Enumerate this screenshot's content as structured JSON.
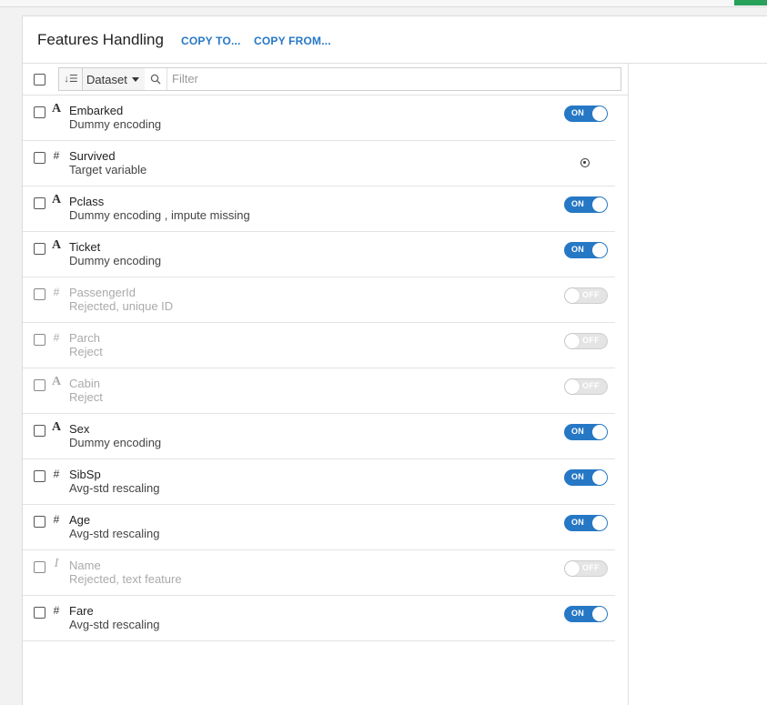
{
  "header": {
    "title": "Features Handling",
    "copy_to_label": "COPY TO...",
    "copy_from_label": "COPY FROM..."
  },
  "toolbar": {
    "sort_icon": "sort-descending-icon",
    "dataset_label": "Dataset",
    "search_icon": "search-icon",
    "filter_placeholder": "Filter",
    "filter_value": ""
  },
  "features": [
    {
      "type": "alpha",
      "icon": "A",
      "name": "Embarked",
      "desc": "Dummy encoding",
      "state": "on",
      "state_label": "ON"
    },
    {
      "type": "numeric",
      "icon": "#",
      "name": "Survived",
      "desc": "Target variable",
      "state": "target",
      "state_label": ""
    },
    {
      "type": "alpha",
      "icon": "A",
      "name": "Pclass",
      "desc": "Dummy encoding , impute missing",
      "state": "on",
      "state_label": "ON"
    },
    {
      "type": "alpha",
      "icon": "A",
      "name": "Ticket",
      "desc": "Dummy encoding",
      "state": "on",
      "state_label": "ON"
    },
    {
      "type": "numeric",
      "icon": "#",
      "name": "PassengerId",
      "desc": "Rejected, unique ID",
      "state": "off",
      "state_label": "OFF"
    },
    {
      "type": "numeric",
      "icon": "#",
      "name": "Parch",
      "desc": "Reject",
      "state": "off",
      "state_label": "OFF"
    },
    {
      "type": "alpha",
      "icon": "A",
      "name": "Cabin",
      "desc": "Reject",
      "state": "off",
      "state_label": "OFF"
    },
    {
      "type": "alpha",
      "icon": "A",
      "name": "Sex",
      "desc": "Dummy encoding",
      "state": "on",
      "state_label": "ON"
    },
    {
      "type": "numeric",
      "icon": "#",
      "name": "SibSp",
      "desc": "Avg-std rescaling",
      "state": "on",
      "state_label": "ON"
    },
    {
      "type": "numeric",
      "icon": "#",
      "name": "Age",
      "desc": "Avg-std rescaling",
      "state": "on",
      "state_label": "ON"
    },
    {
      "type": "text",
      "icon": "I",
      "name": "Name",
      "desc": "Rejected, text feature",
      "state": "off",
      "state_label": "OFF"
    },
    {
      "type": "numeric",
      "icon": "#",
      "name": "Fare",
      "desc": "Avg-std rescaling",
      "state": "on",
      "state_label": "ON"
    }
  ],
  "colors": {
    "accent": "#2678c5",
    "toggle_off": "#e4e4e4",
    "topbar_badge": "#27a05a"
  }
}
